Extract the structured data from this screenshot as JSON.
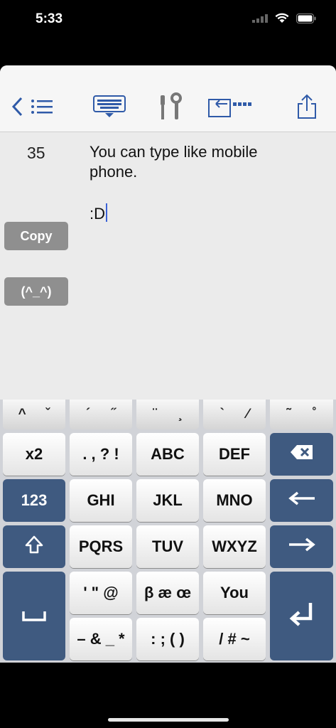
{
  "status": {
    "time": "5:33"
  },
  "editor": {
    "line_number": "35",
    "lines": [
      "You can type like mobile",
      "phone.",
      ":D"
    ]
  },
  "side_buttons": {
    "copy": "Copy",
    "emoticon": "(^_^)"
  },
  "accent_keys": [
    {
      "a": "^",
      "b": "ˇ"
    },
    {
      "a": "´",
      "b": "˝"
    },
    {
      "a": "¨",
      "b": "¸"
    },
    {
      "a": "`",
      "b": "⁄"
    },
    {
      "a": "˜",
      "b": "˚"
    }
  ],
  "keys": {
    "x2": "x2",
    "punct": ". , ? !",
    "abc": "ABC",
    "def": "DEF",
    "num": "123",
    "ghi": "GHI",
    "jkl": "JKL",
    "mno": "MNO",
    "pqrs": "PQRS",
    "tuv": "TUV",
    "wxyz": "WXYZ",
    "quotes": "' \" @",
    "ligatures": "β æ œ",
    "you": "You",
    "symbols1": "– & _ *",
    "symbols2": ": ; ( )",
    "symbols3": "/ # ~"
  },
  "colors": {
    "accent": "#3f5a80",
    "side_button": "#8f8f8f",
    "cursor": "#3b62d6"
  }
}
